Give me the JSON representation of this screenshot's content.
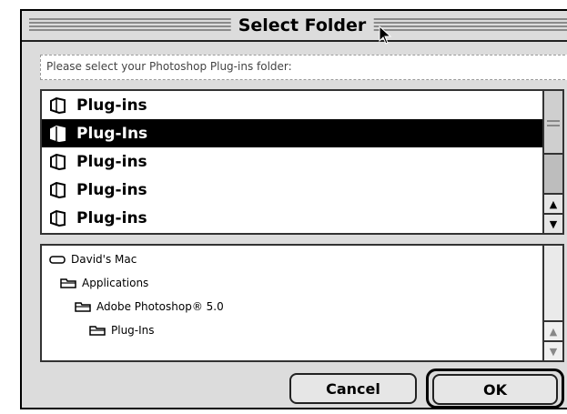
{
  "window": {
    "title": "Select Folder"
  },
  "prompt": {
    "text": "Please select your Photoshop Plug-ins folder:"
  },
  "folder_list": {
    "items": [
      {
        "label": "Plug-ins",
        "selected": false
      },
      {
        "label": "Plug-Ins",
        "selected": true
      },
      {
        "label": "Plug-ins",
        "selected": false
      },
      {
        "label": "Plug-ins",
        "selected": false
      },
      {
        "label": "Plug-ins",
        "selected": false
      }
    ]
  },
  "path_tree": {
    "items": [
      {
        "label": "David's Mac",
        "icon": "hard-drive-icon"
      },
      {
        "label": "Applications",
        "icon": "folder-icon"
      },
      {
        "label": "Adobe Photoshop® 5.0",
        "icon": "folder-icon"
      },
      {
        "label": "Plug-Ins",
        "icon": "folder-icon"
      }
    ]
  },
  "buttons": {
    "cancel": "Cancel",
    "ok": "OK"
  },
  "icons": {
    "scroll_up": "▲",
    "scroll_down": "▼"
  }
}
